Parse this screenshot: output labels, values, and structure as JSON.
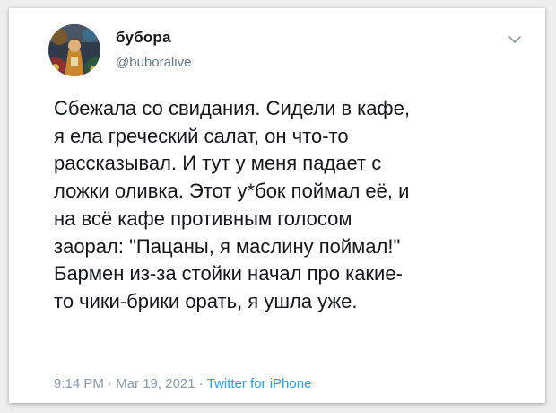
{
  "tweet": {
    "author": {
      "display_name": "бубора",
      "handle": "@buboralive",
      "avatar_icon": "painted-portrait-avatar"
    },
    "menu_icon": "chevron-down-icon",
    "text": "Сбежала со свидания. Сидели в кафе,\nя ела греческий салат, он что-то\nрассказывал. И тут у меня падает с\nложки оливка. Этот у*бок поймал её, и\nна всё кафе противным голосом\nзаорал: \"Пацаны, я маслину поймал!\"\nБармен из-за стойки начал про какие-\nто чики-брики орать, я ушла уже.",
    "time": "9:14 PM",
    "separator": "·",
    "date": "Mar 19, 2021",
    "source": "Twitter for iPhone"
  },
  "colors": {
    "text_primary": "#14171a",
    "text_secondary": "#657786",
    "meta_gray": "#8899a6",
    "link_blue": "#1da1f2",
    "card_bg": "#ffffff",
    "page_bg": "#eeeeee"
  }
}
